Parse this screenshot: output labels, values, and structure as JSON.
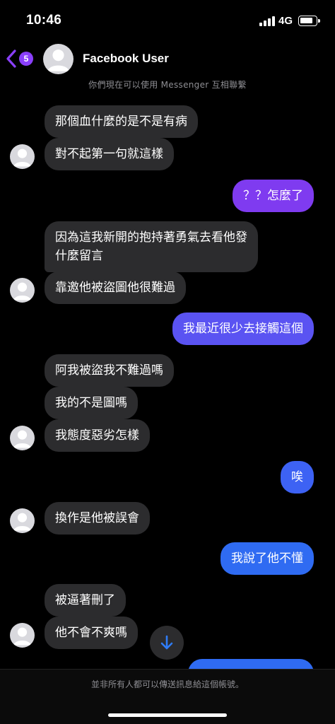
{
  "status_bar": {
    "time": "10:46",
    "network": "4G"
  },
  "header": {
    "back_badge": "5",
    "contact_name": "Facebook User",
    "subtitle": "你們現在可以使用 Messenger 互相聯繫"
  },
  "colors": {
    "incoming_bubble": "#2c2c2e",
    "outgoing_purple": "#7f3bf0",
    "outgoing_blue": "#2f6bf2",
    "badge": "#8a3ffc",
    "scroll_arrow": "#2f7cf6"
  },
  "messages": [
    {
      "side": "in",
      "text": "那個血什麼的是不是有病"
    },
    {
      "side": "in",
      "text": "對不起第一句就這樣"
    },
    {
      "side": "out",
      "text": "？？怎麼了"
    },
    {
      "side": "in",
      "text": "因為這我新開的抱持著勇氣去看他發"
    },
    {
      "side": "in",
      "text": "什麼留言"
    },
    {
      "side": "in",
      "text": "靠邀他被盜圖他很難過"
    },
    {
      "side": "out",
      "text": "我最近很少去接觸這個"
    },
    {
      "side": "in",
      "text": "阿我被盜我不難過嗎"
    },
    {
      "side": "in",
      "text": "我的不是圖嗎"
    },
    {
      "side": "in",
      "text": "我態度惡劣怎樣"
    },
    {
      "side": "out",
      "text": "唉"
    },
    {
      "side": "in",
      "text": "換作是他被誤會"
    },
    {
      "side": "out",
      "text": "我說了他不懂"
    },
    {
      "side": "in",
      "text": "被逼著刪了"
    },
    {
      "side": "in",
      "text": "他不會不爽嗎"
    }
  ],
  "icons": {
    "back": "chevron-left-icon",
    "avatar": "default-avatar-icon",
    "scroll": "arrow-down-icon"
  },
  "footer": {
    "note": "並非所有人都可以傳送訊息給這個帳號。"
  }
}
